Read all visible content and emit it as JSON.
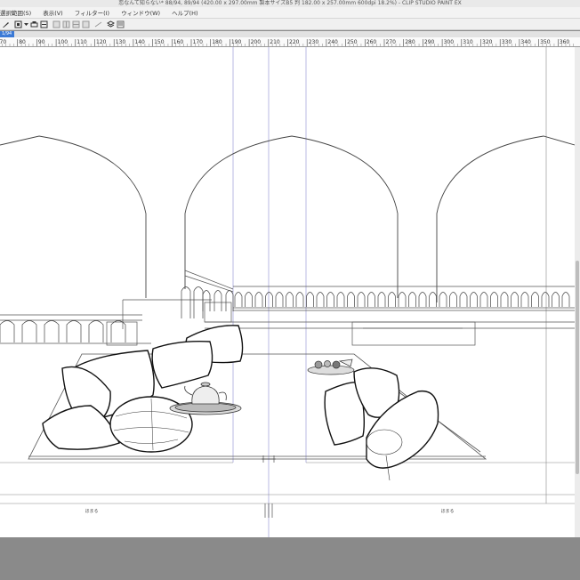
{
  "window": {
    "title": "恋なんて知らない* 88/94, 89/94 (420.00 x 297.00mm 製本サイズB5 判 182.00 x 257.00mm 600dpi 18.2%) - CLIP STUDIO PAINT EX"
  },
  "menu": {
    "items": [
      "選択範囲(S)",
      "表示(V)",
      "フィルター(I)",
      "ウィンドウ(W)",
      "ヘルプ(H)"
    ]
  },
  "toolbar": {
    "icons": [
      "pen-icon",
      "frame-icon",
      "dropdown-icon",
      "print-icon",
      "page-icon",
      "page-icon",
      "page-icon",
      "page-icon",
      "transform-icon",
      "layers-icon",
      "properties-icon"
    ]
  },
  "tab": {
    "label": "1/94"
  },
  "ruler": {
    "ticks": [
      "70",
      "80",
      "90",
      "100",
      "110",
      "120",
      "130",
      "140",
      "150",
      "160",
      "170",
      "180",
      "190",
      "200",
      "210",
      "220",
      "230",
      "240",
      "250",
      "260",
      "270",
      "280",
      "290",
      "300",
      "310",
      "320",
      "330",
      "340",
      "350",
      "360"
    ]
  },
  "canvas": {
    "page_labels": [
      "ほまる",
      "ほまる"
    ]
  },
  "colors": {
    "accent": "#3b7ad6",
    "outside": "#8a8a8a",
    "guide": "#8c8cd0"
  }
}
